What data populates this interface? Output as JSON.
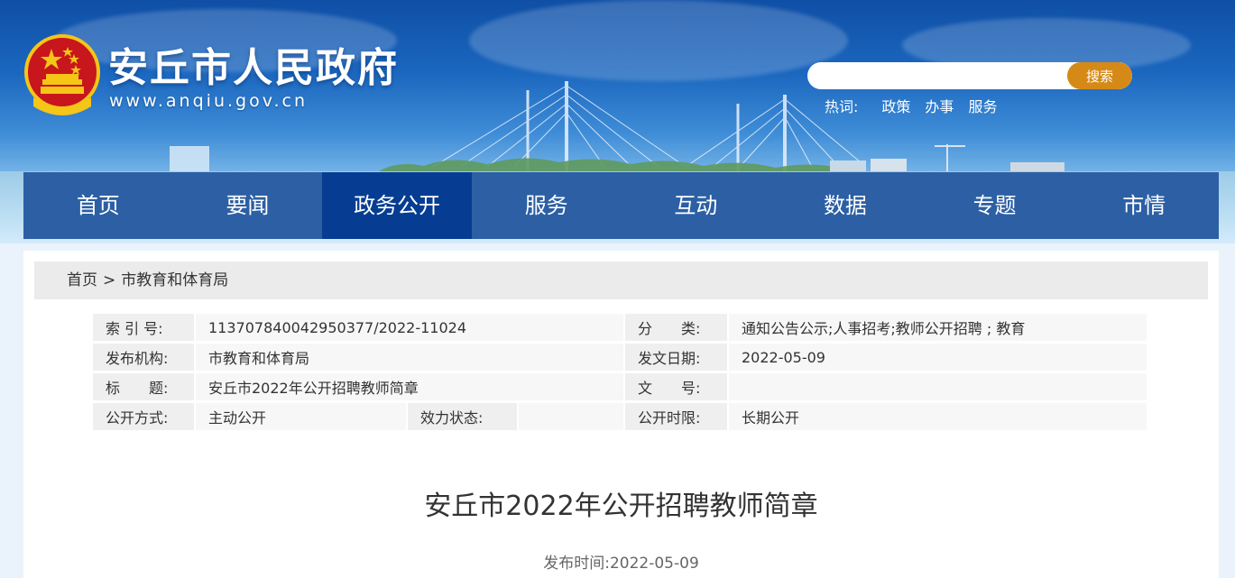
{
  "header": {
    "site_title": "安丘市人民政府",
    "site_url": "www.anqiu.gov.cn",
    "search": {
      "placeholder": "",
      "button_label": "搜索"
    },
    "hotwords": {
      "label": "热词:",
      "items": [
        "政策",
        "办事",
        "服务"
      ]
    }
  },
  "nav": {
    "items": [
      {
        "label": "首页",
        "active": false
      },
      {
        "label": "要闻",
        "active": false
      },
      {
        "label": "政务公开",
        "active": true
      },
      {
        "label": "服务",
        "active": false
      },
      {
        "label": "互动",
        "active": false
      },
      {
        "label": "数据",
        "active": false
      },
      {
        "label": "专题",
        "active": false
      },
      {
        "label": "市情",
        "active": false
      }
    ]
  },
  "breadcrumb": {
    "home": "首页",
    "separator": ">",
    "current": "市教育和体育局"
  },
  "meta": {
    "index_no_label": "索 引 号:",
    "index_no": "113707840042950377/2022-11024",
    "category_label": "分　　类:",
    "category": "通知公告公示;人事招考;教师公开招聘 ; 教育",
    "publisher_label": "发布机构:",
    "publisher": "市教育和体育局",
    "issue_date_label": "发文日期:",
    "issue_date": "2022-05-09",
    "title_label": "标　　题:",
    "title": "安丘市2022年公开招聘教师简章",
    "doc_no_label": "文　　号:",
    "doc_no": "",
    "open_mode_label": "公开方式:",
    "open_mode": "主动公开",
    "validity_label": "效力状态:",
    "validity": "",
    "open_period_label": "公开时限:",
    "open_period": "长期公开"
  },
  "article": {
    "title": "安丘市2022年公开招聘教师简章",
    "publish_time_label": "发布时间:",
    "publish_time": "2022-05-09"
  },
  "colors": {
    "nav_bg": "#2c5fa4",
    "nav_active": "#063d93",
    "search_button": "#d58a17",
    "breadcrumb_bg": "#ebebeb"
  }
}
